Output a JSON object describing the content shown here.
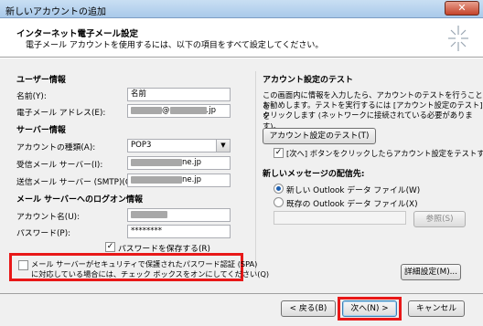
{
  "window": {
    "title": "新しいアカウントの追加",
    "close_glyph": "✕"
  },
  "header": {
    "title": "インターネット電子メール設定",
    "subtitle": "電子メール アカウントを使用するには、以下の項目をすべて設定してください。"
  },
  "user_info": {
    "section": "ユーザー情報",
    "name_label": "名前(Y):",
    "name_value": "名前",
    "email_label": "電子メール アドレス(E):",
    "email_at": "@",
    "email_tail": ".jp"
  },
  "server_info": {
    "section": "サーバー情報",
    "account_type_label": "アカウントの種類(A):",
    "account_type_value": "POP3",
    "incoming_label": "受信メール サーバー(I):",
    "incoming_tail": "ne.jp",
    "outgoing_label": "送信メール サーバー (SMTP)(O):",
    "outgoing_tail": "ne.jp"
  },
  "logon_info": {
    "section": "メール サーバーへのログオン情報",
    "account_label": "アカウント名(U):",
    "password_label": "パスワード(P):",
    "password_value": "********",
    "remember_label": "パスワードを保存する(R)",
    "spa_line1": "メール サーバーがセキュリティで保護されたパスワード認証 (SPA)",
    "spa_line2": "に対応している場合には、チェック ボックスをオンにしてください(Q)"
  },
  "test": {
    "section": "アカウント設定のテスト",
    "desc_line1": "この画面内に情報を入力したら、アカウントのテストを行うことを",
    "desc_line2": "お勧めします。テストを実行するには [アカウント設定のテスト] を",
    "desc_line3": "クリックします (ネットワークに接続されている必要があります)。",
    "test_button": "アカウント設定のテスト(T)",
    "auto_test_label": "[次へ] ボタンをクリックしたらアカウント設定をテストする(S)"
  },
  "delivery": {
    "section": "新しいメッセージの配信先:",
    "option_new": "新しい Outlook データ ファイル(W)",
    "option_existing": "既存の Outlook データ ファイル(X)",
    "browse_button": "参照(S)"
  },
  "more_settings_button": "詳細設定(M)...",
  "footer": {
    "back": "< 戻る(B)",
    "next": "次へ(N) >",
    "cancel": "キャンセル"
  }
}
